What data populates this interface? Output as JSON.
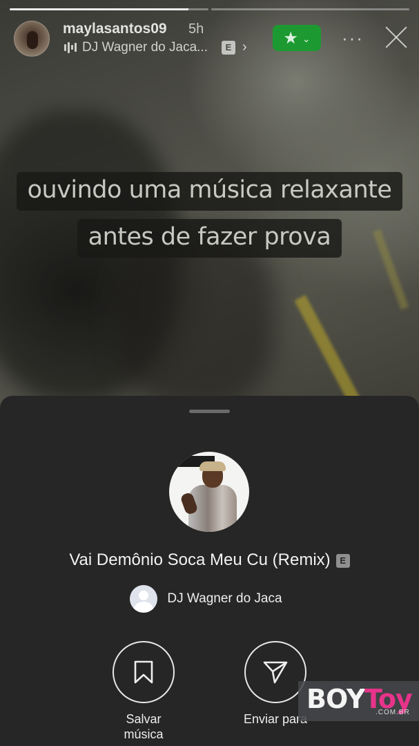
{
  "story": {
    "progress_segments": [
      {
        "filled_fraction": 0.9
      },
      {
        "filled_fraction": 0.0
      }
    ],
    "username": "maylasantos09",
    "time_ago": "5h",
    "music_attribution": "DJ Wagner do Jaca...",
    "explicit_badge": "E",
    "close_friends_icon": "star-icon",
    "more_label": "···",
    "caption_lines": [
      "ouvindo uma música relaxante",
      "antes de fazer prova"
    ]
  },
  "sheet": {
    "song_title": "Vai Demônio Soca Meu Cu (Remix)",
    "explicit_badge": "E",
    "artist_name": "DJ Wagner do Jaca",
    "actions": [
      {
        "icon": "bookmark-icon",
        "label": "Salvar música"
      },
      {
        "icon": "send-icon",
        "label": "Enviar para"
      }
    ]
  },
  "watermark": {
    "part1": "BOY",
    "part2": "Toy",
    "domain": ".COM.BR"
  },
  "colors": {
    "sheet_bg": "#262626",
    "close_friends_green": "#1c9a31",
    "watermark_pink": "#e7348a"
  }
}
